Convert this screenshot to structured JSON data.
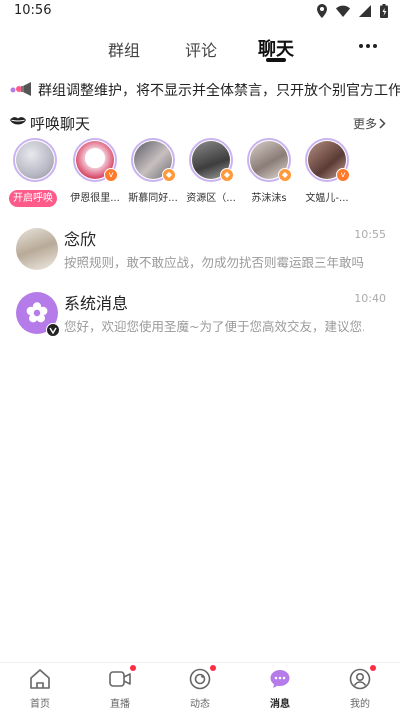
{
  "status_bar": {
    "time": "10:56"
  },
  "tabs": [
    {
      "label": "群组"
    },
    {
      "label": "评论"
    },
    {
      "label": "聊天"
    }
  ],
  "notice": {
    "text": "群组调整维护，将不显示并全体禁言，只开放个别官方工作群..."
  },
  "call_section": {
    "title": "呼唤聊天",
    "more_label": "更多",
    "open_call_label": "开启呼唤",
    "avatars": [
      {
        "name": "",
        "badge": ""
      },
      {
        "name": "伊恩很里...",
        "badge": "v"
      },
      {
        "name": "斯慕同好...",
        "badge": "diamond"
      },
      {
        "name": "资源区（...",
        "badge": "diamond"
      },
      {
        "name": "苏沫沫s",
        "badge": "diamond"
      },
      {
        "name": "文媪儿-...",
        "badge": "v"
      }
    ]
  },
  "conversations": [
    {
      "name": "念欣",
      "message": "按照规则，敢不敢应战，勿成勿扰否则霉运跟三年敢吗",
      "time": "10:55"
    },
    {
      "name": "系统消息",
      "message": "您好，欢迎您使用圣魔~为了便于您高效交友，建议您...",
      "time": "10:40"
    }
  ],
  "bottom_nav": [
    {
      "label": "首页",
      "icon": "home-icon",
      "dot": false
    },
    {
      "label": "直播",
      "icon": "video-icon",
      "dot": true
    },
    {
      "label": "动态",
      "icon": "moments-icon",
      "dot": true
    },
    {
      "label": "消息",
      "icon": "message-icon",
      "dot": false
    },
    {
      "label": "我的",
      "icon": "profile-icon",
      "dot": true
    }
  ],
  "colors": {
    "accent_pink": "#ff5b8a",
    "accent_purple": "#b57be8",
    "ring": "#c9b3f0",
    "badge_orange": "#ff7a2a",
    "red_dot": "#ff2a43"
  }
}
